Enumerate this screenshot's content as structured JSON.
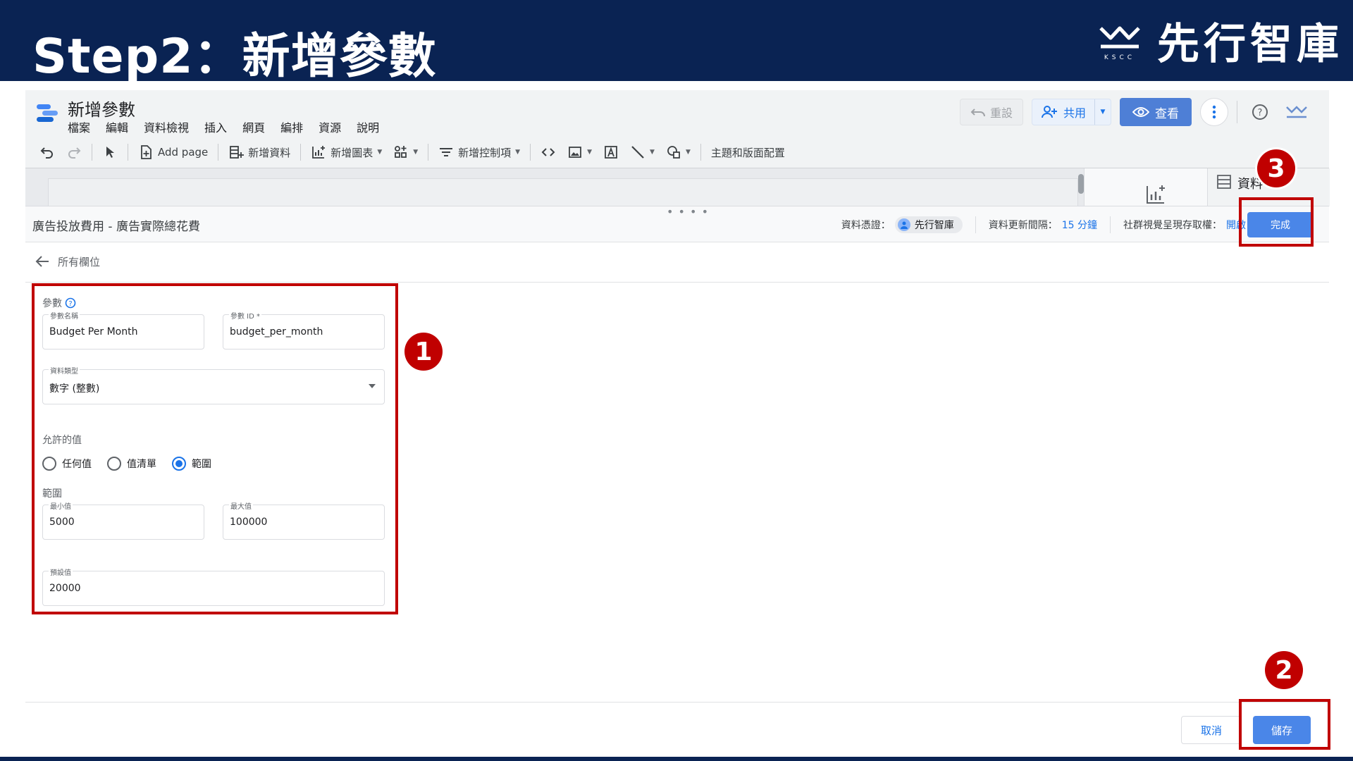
{
  "banner": {
    "title": "Step2：新增參數",
    "brand_name": "先行智庫",
    "brand_logo_icon": "mountain-logo-icon",
    "color": "#0a2353"
  },
  "app": {
    "doc_title": "新增參數",
    "menu": [
      "檔案",
      "編輯",
      "資料檢視",
      "插入",
      "網頁",
      "編排",
      "資源",
      "說明"
    ],
    "actions": {
      "reset_label": "重設",
      "share_label": "共用",
      "view_label": "查看"
    },
    "toolbar": {
      "add_page": "Add page",
      "add_data": "新增資料",
      "add_chart": "新增圖表",
      "add_control": "新增控制項",
      "theme": "主題和版面配置"
    },
    "side_panel": {
      "data_tab_label": "資料"
    }
  },
  "editor": {
    "data_source": "廣告投放費用 - 廣告實際總花費",
    "credentials_label": "資料憑證：",
    "credentials_owner": "先行智庫",
    "refresh_label": "資料更新間隔：",
    "refresh_value": "15 分鐘",
    "community_label": "社群視覺呈現存取權：",
    "community_value": "開啟",
    "done_label": "完成",
    "back_label": "所有欄位",
    "form": {
      "section_label": "參數",
      "name_label": "參數名稱",
      "name_value": "Budget Per Month",
      "id_label": "參數 ID *",
      "id_value": "budget_per_month",
      "type_label": "資料類型",
      "type_value": "數字 (整數)",
      "allowed_label": "允許的值",
      "options": [
        "任何值",
        "值清單",
        "範圍"
      ],
      "selected_option": "範圍",
      "range_label": "範圍",
      "min_label": "最小值",
      "min_value": "5000",
      "max_label": "最大值",
      "max_value": "100000",
      "default_label": "預設值",
      "default_value": "20000"
    },
    "cancel_label": "取消",
    "save_label": "儲存"
  },
  "annotations": {
    "badges": [
      "1",
      "2",
      "3"
    ],
    "color": "#c00000"
  }
}
